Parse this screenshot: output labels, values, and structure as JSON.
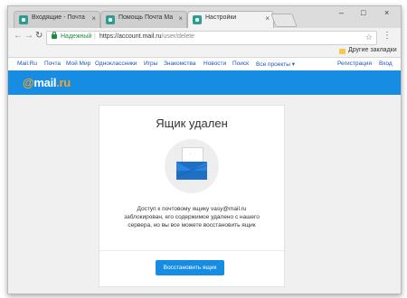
{
  "browser": {
    "tabs": [
      {
        "label": "Входящие - Почта Mail.Ru",
        "close": "×"
      },
      {
        "label": "Помощь Почта Mail.Ru",
        "close": "×"
      },
      {
        "label": "Настройки",
        "close": "×"
      }
    ],
    "window_controls": {
      "minimize": "–",
      "maximize": "□",
      "close": "×"
    },
    "secure_label": "Надежный",
    "url_domain": "https://account.mail.ru",
    "url_path": "/user/delete",
    "bookmarks_folder": "Другие закладки"
  },
  "portal_nav": {
    "left": [
      "Mail.Ru",
      "Почта",
      "Мой Мир",
      "Одноклассники",
      "Игры",
      "Знакомства",
      "Новости",
      "Поиск",
      "Все проекты ▾"
    ],
    "right": [
      "Регистрация",
      "Вход"
    ]
  },
  "logo": {
    "at": "@",
    "name": "mail",
    "tld": ".ru"
  },
  "card": {
    "title": "Ящик удален",
    "description": "Доступ к почтовому ящику vasy@mail.ru заблокирован, его содержимое удалено с нашего сервера, но вы все можете восстановить ящик",
    "restore_button": "Восстановить ящик"
  },
  "colors": {
    "accent": "#168de2",
    "logo_accent": "#f7a520",
    "secure": "#1f8a3f"
  },
  "icons": [
    "favicon-icon",
    "back-icon",
    "forward-icon",
    "reload-icon",
    "lock-icon",
    "star-icon",
    "menu-icon",
    "folder-icon",
    "envelope-icon"
  ]
}
